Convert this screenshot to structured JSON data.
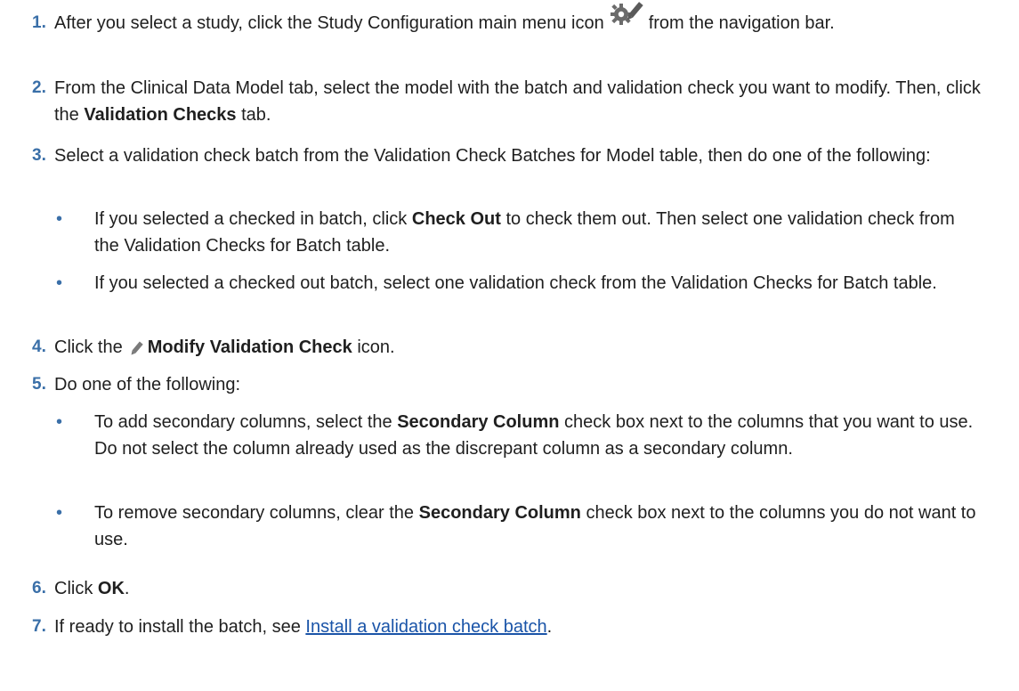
{
  "steps": [
    {
      "num": "1.",
      "before": "After you select a study, click the Study Configuration main menu icon",
      "after": "from the navigation bar.",
      "icon": "gear-pencil-icon"
    },
    {
      "num": "2.",
      "before": "From the Clinical Data Model tab, select the model with the batch and validation check you want to modify. Then, click the",
      "bold": "Validation Checks",
      "after": "tab."
    },
    {
      "num": "3.",
      "text": "Select a validation check batch from the Validation Check Batches for Model table, then do one of the following:",
      "bullets": [
        {
          "before": "If you selected a checked in batch, click",
          "bold": "Check Out",
          "after": "to check them out. Then select one validation check from the Validation Checks for Batch table."
        },
        {
          "text": "If you selected a checked out batch, select one validation check from the Validation Checks for Batch table."
        }
      ]
    },
    {
      "num": "4.",
      "before": "Click the",
      "icon": "pencil-icon",
      "bold": "Modify Validation Check",
      "after": "icon."
    },
    {
      "num": "5.",
      "text": "Do one of the following:",
      "bullets": [
        {
          "before": "To add secondary columns, select the",
          "bold": "Secondary Column",
          "after": "check box next to the columns that you want to use. Do not select the column already used as the discrepant column as a secondary column."
        },
        {
          "before": "To remove secondary columns, clear the",
          "bold": "Secondary Column",
          "after": "check box next to the columns you do not want to use."
        }
      ]
    },
    {
      "num": "6.",
      "before": "Click",
      "bold": "OK",
      "after": "."
    },
    {
      "num": "7.",
      "before": "If ready to install the batch, see",
      "link": "Install a validation check batch",
      "after": "."
    }
  ],
  "bullet_char": "•",
  "colors": {
    "number": "#3a6fa8",
    "link": "#1a54a8",
    "text": "#1f1f1f"
  }
}
